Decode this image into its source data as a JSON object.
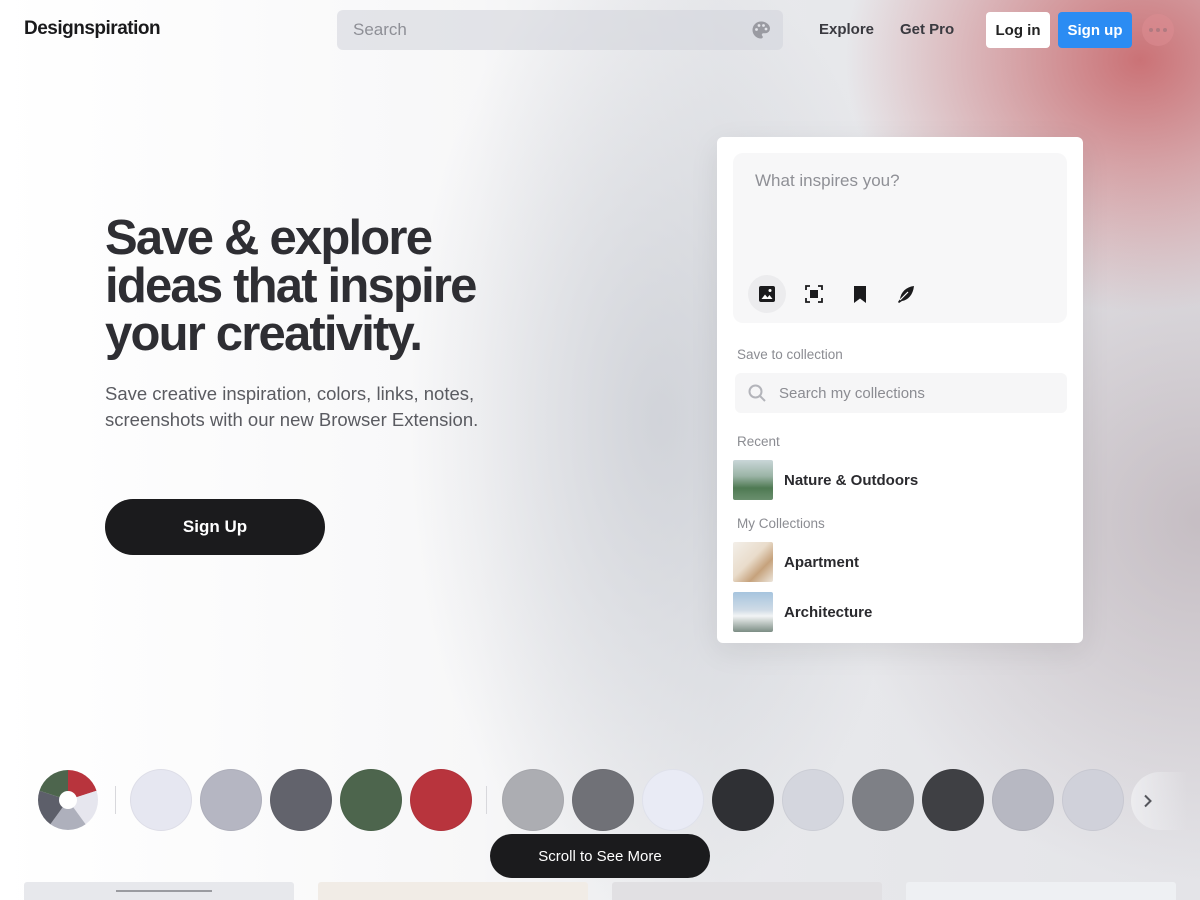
{
  "header": {
    "logo": "Designspiration",
    "search_placeholder": "Search",
    "nav": {
      "explore": "Explore",
      "get_pro": "Get Pro"
    },
    "login_label": "Log in",
    "signup_label": "Sign up"
  },
  "hero": {
    "title": "Save & explore ideas that inspire your creativity.",
    "subtitle": "Save creative inspiration, colors, links, notes, screenshots with our new Browser Extension.",
    "cta_label": "Sign Up"
  },
  "panel": {
    "compose_placeholder": "What inspires you?",
    "tools": [
      "image-icon",
      "screenshot-icon",
      "bookmark-icon",
      "feather-icon"
    ],
    "save_to_collection_label": "Save to collection",
    "collection_search_placeholder": "Search my collections",
    "recent_label": "Recent",
    "recent": [
      {
        "name": "Nature & Outdoors"
      }
    ],
    "my_collections_label": "My Collections",
    "collections": [
      {
        "name": "Apartment"
      },
      {
        "name": "Architecture"
      }
    ]
  },
  "palette": {
    "wheel_colors": [
      "#b8343d",
      "#e6e6ee",
      "#aeb0bc",
      "#5d5f6a",
      "#4d654d"
    ],
    "group1": [
      "#e6e7f1",
      "#b5b6c2",
      "#62636c",
      "#4d654d",
      "#b8343d"
    ],
    "group2": [
      "#acadb2",
      "#707177",
      "#e9ebf5",
      "#2f3034",
      "#d4d6de",
      "#7e8086",
      "#3f4044",
      "#b7b8c2",
      "#d0d1da"
    ]
  },
  "footer": {
    "scroll_label": "Scroll to See More"
  }
}
